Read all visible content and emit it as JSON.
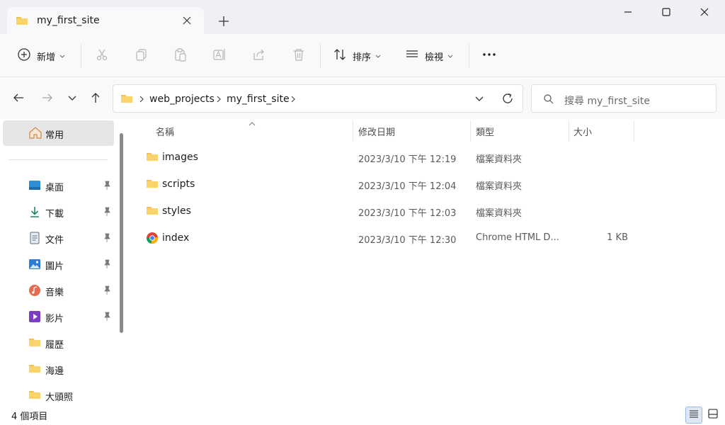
{
  "window": {
    "tab_title": "my_first_site",
    "new_tab_label": "+"
  },
  "toolbar": {
    "new_label": "新增",
    "sort_label": "排序",
    "view_label": "檢視",
    "more_label": "•••"
  },
  "address": {
    "breadcrumbs": [
      "web_projects",
      "my_first_site"
    ],
    "search_placeholder": "搜尋 my_first_site"
  },
  "sidebar": {
    "home_label": "常用",
    "items": [
      {
        "label": "桌面",
        "icon": "desktop-icon",
        "pinned": true
      },
      {
        "label": "下載",
        "icon": "download-icon",
        "pinned": true
      },
      {
        "label": "文件",
        "icon": "document-icon",
        "pinned": true
      },
      {
        "label": "圖片",
        "icon": "pictures-icon",
        "pinned": true
      },
      {
        "label": "音樂",
        "icon": "music-icon",
        "pinned": true
      },
      {
        "label": "影片",
        "icon": "video-icon",
        "pinned": true
      },
      {
        "label": "履歷",
        "icon": "folder-icon",
        "pinned": false
      },
      {
        "label": "海邊",
        "icon": "folder-icon",
        "pinned": false
      },
      {
        "label": "大頭照",
        "icon": "folder-icon",
        "pinned": false
      }
    ]
  },
  "columns": {
    "name": "名稱",
    "modified": "修改日期",
    "type": "類型",
    "size": "大小"
  },
  "files": [
    {
      "name": "images",
      "modified": "2023/3/10 下午 12:19",
      "type": "檔案資料夾",
      "size": "",
      "icon": "folder-icon"
    },
    {
      "name": "scripts",
      "modified": "2023/3/10 下午 12:04",
      "type": "檔案資料夾",
      "size": "",
      "icon": "folder-icon"
    },
    {
      "name": "styles",
      "modified": "2023/3/10 下午 12:03",
      "type": "檔案資料夾",
      "size": "",
      "icon": "folder-icon"
    },
    {
      "name": "index",
      "modified": "2023/3/10 下午 12:30",
      "type": "Chrome HTML D...",
      "size": "1 KB",
      "icon": "chrome-icon"
    }
  ],
  "status": {
    "item_count": "4 個項目"
  },
  "colors": {
    "folder": "#f3c14b",
    "accent": "#0067c0",
    "titlebar": "#eef0f5"
  }
}
